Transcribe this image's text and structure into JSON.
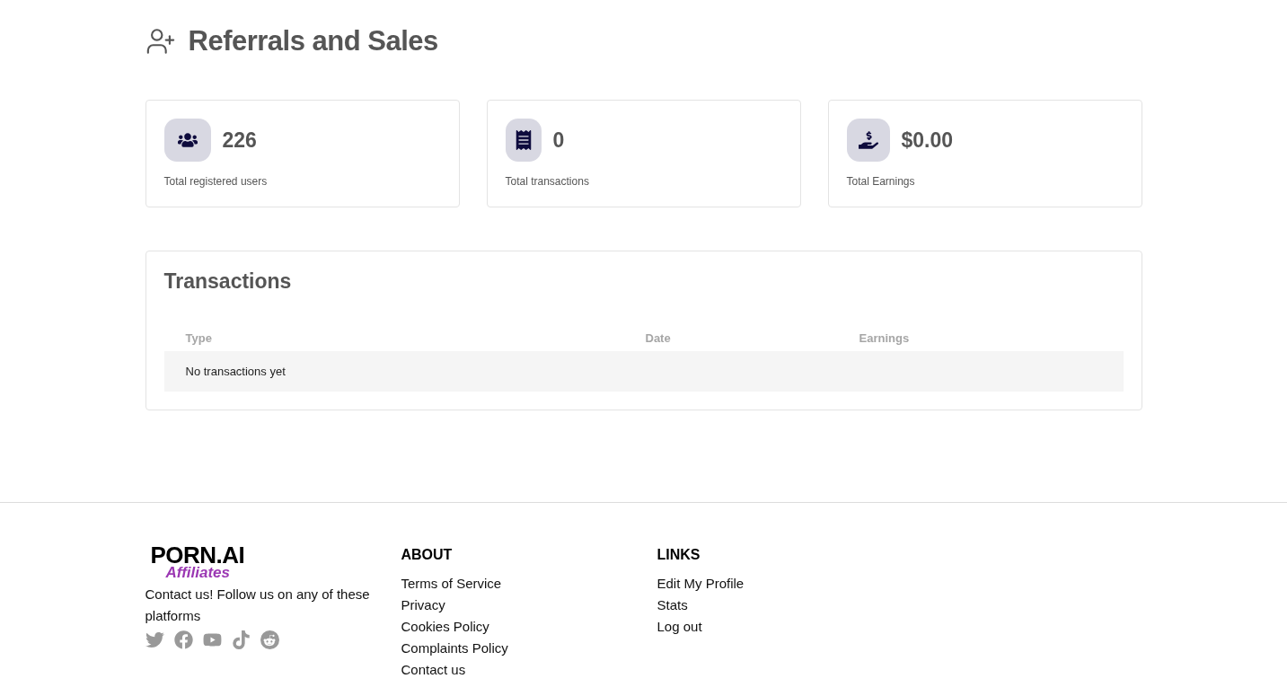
{
  "header": {
    "title": "Referrals and Sales"
  },
  "stats": [
    {
      "kind": "users",
      "value": "226",
      "label": "Total registered users"
    },
    {
      "kind": "transactions",
      "value": "0",
      "label": "Total transactions"
    },
    {
      "kind": "earnings",
      "value": "$0.00",
      "label": "Total Earnings"
    }
  ],
  "transactions": {
    "title": "Transactions",
    "columns": [
      "Type",
      "Date",
      "Earnings"
    ],
    "empty_message": "No transactions yet"
  },
  "footer": {
    "logo": {
      "name": "PORN.AI",
      "tagline": "Affiliates"
    },
    "contact_text": "Contact us! Follow us on any of these platforms",
    "socials": [
      {
        "kind": "twitter"
      },
      {
        "kind": "facebook"
      },
      {
        "kind": "youtube"
      },
      {
        "kind": "tiktok"
      },
      {
        "kind": "reddit"
      }
    ],
    "sections": [
      {
        "title": "ABOUT",
        "links": [
          "Terms of Service",
          "Privacy",
          "Cookies Policy",
          "Complaints Policy",
          "Contact us"
        ]
      },
      {
        "title": "LINKS",
        "links": [
          "Edit My Profile",
          "Stats",
          "Log out"
        ]
      }
    ]
  }
}
